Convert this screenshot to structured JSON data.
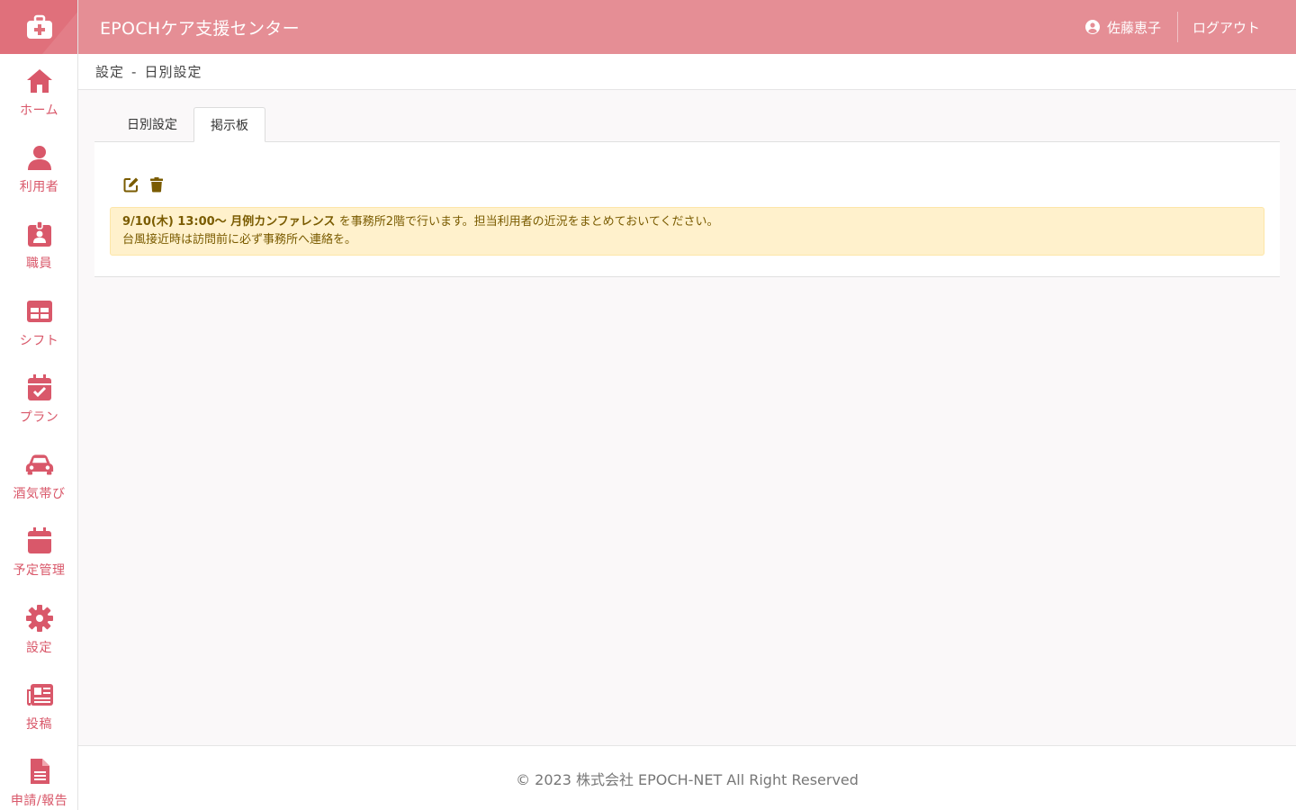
{
  "app": {
    "title": "EPOCHケア支援センター",
    "accent_color": "#e58e95",
    "sidebar_accent": "#d9586a",
    "logo_icon": "medical-kit-icon"
  },
  "header": {
    "user_name": "佐藤恵子",
    "user_icon": "user-circle-icon",
    "logout_label": "ログアウト"
  },
  "sidebar": {
    "items": [
      {
        "label": "ホーム",
        "icon": "home-icon"
      },
      {
        "label": "利用者",
        "icon": "user-icon"
      },
      {
        "label": "職員",
        "icon": "id-badge-icon"
      },
      {
        "label": "シフト",
        "icon": "table-icon"
      },
      {
        "label": "プラン",
        "icon": "calendar-check-icon"
      },
      {
        "label": "酒気帯び",
        "icon": "car-icon"
      },
      {
        "label": "予定管理",
        "icon": "calendar-icon"
      },
      {
        "label": "設定",
        "icon": "gear-icon"
      },
      {
        "label": "投稿",
        "icon": "newspaper-icon"
      },
      {
        "label": "申請/報告",
        "icon": "file-icon"
      }
    ]
  },
  "breadcrumb": {
    "section": "設定",
    "separator": "-",
    "page": "日別設定"
  },
  "tabs": [
    {
      "label": "日別設定",
      "active": false
    },
    {
      "label": "掲示板",
      "active": true
    }
  ],
  "board": {
    "edit_icon": "edit-icon",
    "delete_icon": "trash-icon",
    "notice_bold": "9/10(木) 13:00〜 月例カンファレンス",
    "notice_rest": " を事務所2階で行います。担当利用者の近況をまとめておいてください。",
    "notice_line2": "台風接近時は訪問前に必ず事務所へ連絡を。"
  },
  "footer": {
    "copyright": "© 2023 株式会社 EPOCH-NET All Right Reserved"
  }
}
